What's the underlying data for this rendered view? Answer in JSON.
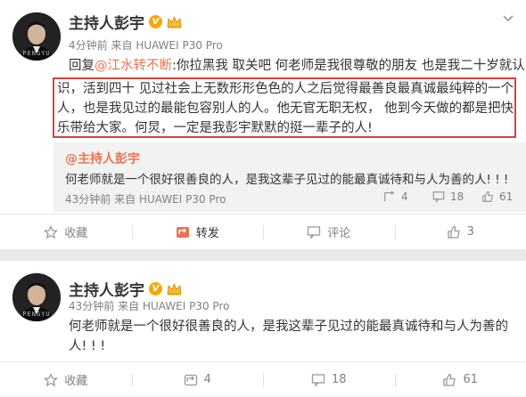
{
  "posts": [
    {
      "author": "主持人彭宇",
      "verified_badge": "V",
      "avatar_caption": "PENGYU",
      "time": "4分钟前",
      "source_prefix": "来自",
      "source": "HUAWEI P30 Pro",
      "text": {
        "prefix": "回复",
        "mention": "@江水转不断",
        "line1_rest": ":你拉黑我 取关吧  何老师是我很尊敬的朋友 也是我二十岁就认",
        "line2": "识，活到四十 见过社会上无数形形色色的人之后觉得最善良最真诚最纯粹的一个",
        "line3": "人，也是我见过的最能包容别人的人。他无官无职无权， 他到今天做的都是把快",
        "line4": "乐带给大家。何炅，一定是我彭宇默默的挺一辈子的人!"
      },
      "repost": {
        "author": "@主持人彭宇",
        "text": "何老师就是一个很好很善良的人，是我这辈子见过的能最真诚待和与人为善的人! ! !",
        "time": "43分钟前",
        "source_prefix": "来自",
        "source": "HUAWEI P30 Pro",
        "stats": {
          "reposts": "4",
          "comments": "18",
          "likes": "61"
        }
      },
      "actions": {
        "collect": "收藏",
        "repost": "转发",
        "comment": "评论",
        "like": "3"
      }
    },
    {
      "author": "主持人彭宇",
      "verified_badge": "V",
      "avatar_caption": "PENGYU",
      "time": "43分钟前",
      "source_prefix": "来自",
      "source": "HUAWEI P30 Pro",
      "text": {
        "line1": "何老师就是一个很好很善良的人，是我这辈子见过的能最真诚待和与人为善的",
        "line2": "人! ! !"
      },
      "actions": {
        "collect": "收藏",
        "repost": "4",
        "comment": "18",
        "like": "61"
      }
    }
  ],
  "icons": {
    "verified": "verified-v-badge",
    "vip": "crown-icon",
    "menu": "chevron-down-icon",
    "collect": "star-icon",
    "repost": "repost-icon",
    "comment": "comment-icon",
    "like": "thumbs-up-icon"
  },
  "colors": {
    "link": "#eb7350",
    "highlight_border": "#d9433b",
    "badge": "#f7a800",
    "repost_bg": "#f2f2f2"
  }
}
